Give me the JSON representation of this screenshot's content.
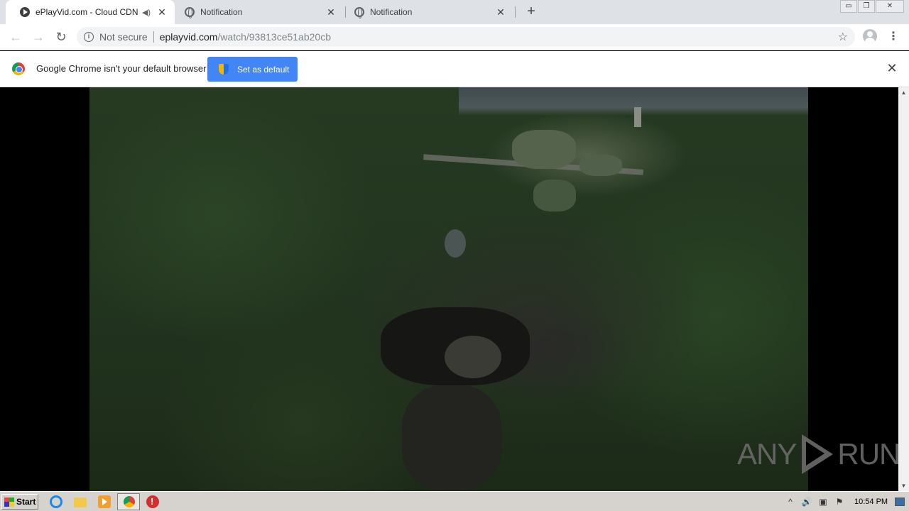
{
  "browser": {
    "tabs": [
      {
        "title": "ePlayVid.com - Cloud CDN",
        "active": true,
        "audio_icon": "speaker-icon",
        "favicon": "eplayvid-favicon"
      },
      {
        "title": "Notification",
        "active": false,
        "favicon": "globe-icon"
      },
      {
        "title": "Notification",
        "active": false,
        "favicon": "globe-icon"
      }
    ],
    "tab_close_glyph": "✕",
    "new_tab_glyph": "+",
    "window_controls": [
      "▭",
      "❐",
      "✕"
    ],
    "nav": {
      "back_glyph": "←",
      "forward_glyph": "→",
      "reload_glyph": "↻"
    },
    "omnibox": {
      "security_label": "Not secure",
      "url_host": "eplayvid.com",
      "url_path": "/watch/93813ce51ab20cb",
      "bookmark_glyph": "☆"
    },
    "menu_glyph": "⋮"
  },
  "infobar": {
    "message": "Google Chrome isn't your default browser",
    "button_label": "Set as default",
    "close_glyph": "✕"
  },
  "page": {
    "video_description": "aerial-forest-footage",
    "watermark_left": "ANY",
    "watermark_right": "RUN"
  },
  "scrollbar": {
    "up_glyph": "▲",
    "down_glyph": "▼"
  },
  "taskbar": {
    "start_label": "Start",
    "tray_icons": [
      "^",
      "🔊",
      "▣",
      "⚑"
    ],
    "clock": "10:54 PM"
  },
  "colors": {
    "tabstrip_bg": "#dee1e6",
    "accent_button": "#4285f4",
    "taskbar_bg": "#d6d3ce"
  }
}
